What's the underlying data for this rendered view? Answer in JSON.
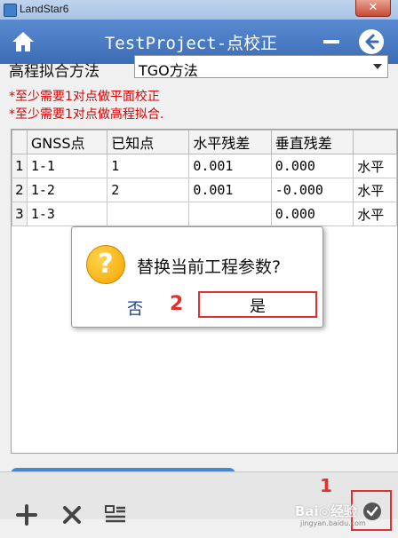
{
  "window": {
    "title": "LandStar6",
    "close_glyph": "✕"
  },
  "header": {
    "title": "TestProject-点校正"
  },
  "form": {
    "label": "高程拟合方法",
    "selected": "TGO方法"
  },
  "warnings": [
    "*至少需要1对点做平面校正",
    "*至少需要1对点做高程拟合."
  ],
  "table": {
    "columns": [
      "GNSS点",
      "已知点",
      "水平残差",
      "垂直残差",
      ""
    ],
    "rows": [
      {
        "num": "1",
        "cells": [
          "1-1",
          "1",
          "0.001",
          "0.000",
          "水平"
        ]
      },
      {
        "num": "2",
        "cells": [
          "1-2",
          "2",
          "0.001",
          "-0.000",
          "水平"
        ]
      },
      {
        "num": "3",
        "cells": [
          "1-3",
          "",
          "",
          "0.000",
          "水平"
        ]
      }
    ]
  },
  "dialog": {
    "message": "替换当前工程参数?",
    "no_label": "否",
    "yes_label": "是",
    "annotation": "2"
  },
  "toolbar": {
    "annotation": "1"
  },
  "watermark": {
    "text": "Bai◎经验",
    "sub": "jingyan.baidu.com"
  },
  "colors": {
    "header": "#3c6cb5",
    "warning": "#e00000",
    "annotation": "#e03030"
  }
}
